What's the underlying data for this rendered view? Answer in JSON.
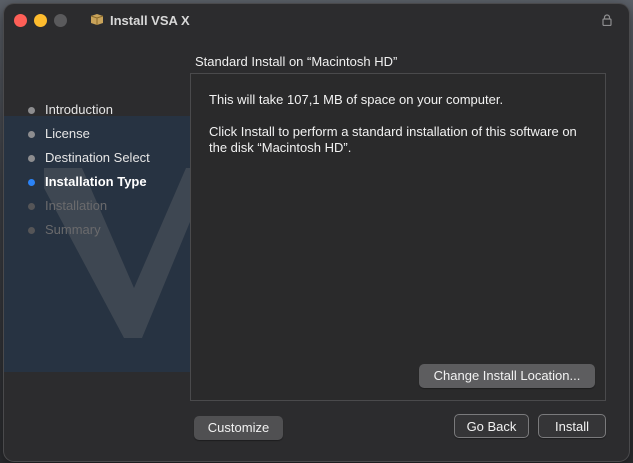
{
  "window": {
    "title": "Install VSA X",
    "icons": {
      "app": "package-icon",
      "lock": "lock-icon"
    }
  },
  "sidebar": {
    "steps": [
      {
        "label": "Introduction",
        "state": "done"
      },
      {
        "label": "License",
        "state": "done"
      },
      {
        "label": "Destination Select",
        "state": "done"
      },
      {
        "label": "Installation Type",
        "state": "current"
      },
      {
        "label": "Installation",
        "state": "future"
      },
      {
        "label": "Summary",
        "state": "future"
      }
    ]
  },
  "main": {
    "heading": "Standard Install on “Macintosh HD”",
    "line1": "This will take 107,1 MB of space on your computer.",
    "line2": "Click Install to perform a standard installation of this software on the disk “Macintosh HD”.",
    "change_location_label": "Change Install Location..."
  },
  "footer": {
    "customize_label": "Customize",
    "go_back_label": "Go Back",
    "install_label": "Install"
  },
  "colors": {
    "accent": "#2b83f6",
    "close": "#fe5f57",
    "minimize": "#febc2e"
  }
}
